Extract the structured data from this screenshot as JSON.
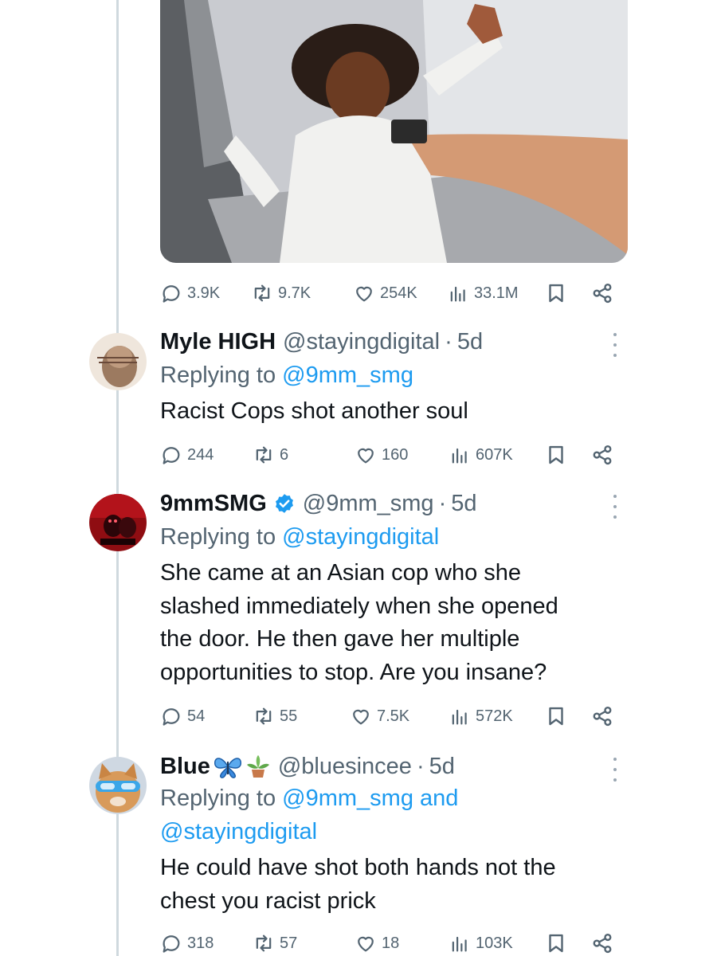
{
  "main_post": {
    "media_description": "video frame",
    "stats": {
      "replies": "3.9K",
      "reposts": "9.7K",
      "likes": "254K",
      "views": "33.1M"
    }
  },
  "replies": [
    {
      "name": "Myle HIGH",
      "handle": "@stayingdigital",
      "separator": "·",
      "time": "5d",
      "replying_prefix": "Replying to",
      "replying_to": "@9mm_smg",
      "text": "Racist Cops shot another soul",
      "stats": {
        "replies": "244",
        "reposts": "6",
        "likes": "160",
        "views": "607K"
      },
      "avatar_icon": "portrait-avatar"
    },
    {
      "name": "9mmSMG",
      "verified": true,
      "handle": "@9mm_smg",
      "separator": "·",
      "time": "5d",
      "replying_prefix": "Replying to",
      "replying_to": "@stayingdigital",
      "text_lines": [
        "She came at an Asian cop who she",
        "slashed immediately when she opened",
        "the door. He then gave her multiple",
        "opportunities to stop. Are you insane?"
      ],
      "stats": {
        "replies": "54",
        "reposts": "55",
        "likes": "7.5K",
        "views": "572K"
      },
      "avatar_icon": "red-figure-avatar"
    },
    {
      "name": "Blue",
      "name_emoji": [
        "butterfly-icon",
        "potted-plant-icon"
      ],
      "handle": "@bluesincee",
      "separator": "·",
      "time": "5d",
      "replying_prefix": "Replying to",
      "replying_to": "@9mm_smg",
      "replying_conj": "and",
      "replying_to_2": "@stayingdigital",
      "text_lines": [
        "He could have shot both hands not the",
        "chest you racist prick"
      ],
      "stats": {
        "replies": "318",
        "reposts": "57",
        "likes": "18",
        "views": "103K"
      },
      "avatar_icon": "cat-sunglasses-avatar"
    }
  ],
  "colors": {
    "text": "#0f1419",
    "muted": "#536471",
    "link": "#1d9bf0",
    "thread_line": "#cfd9de",
    "verified": "#1d9bf0"
  }
}
